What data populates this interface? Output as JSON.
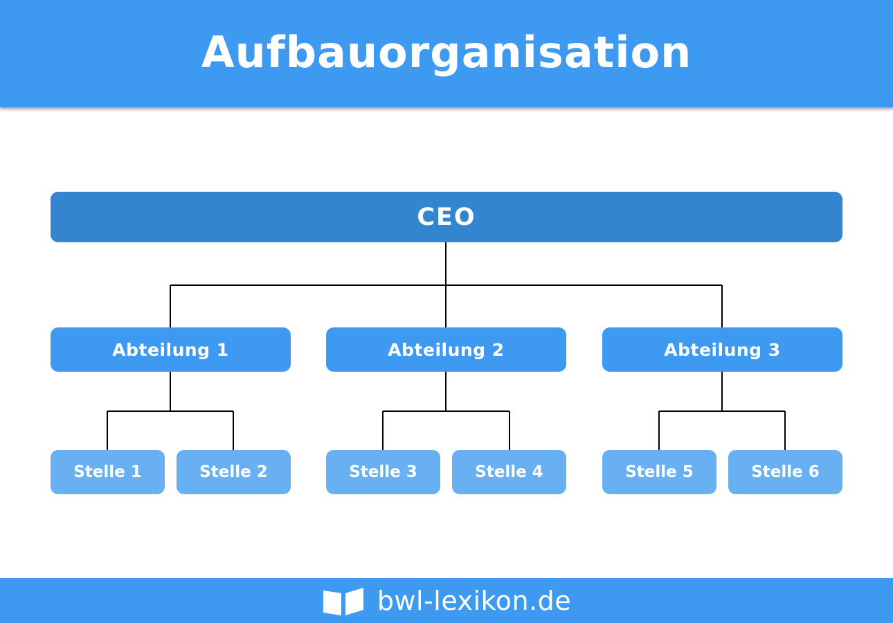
{
  "header": {
    "title": "Aufbauorganisation"
  },
  "org_chart": {
    "root": {
      "label": "CEO"
    },
    "departments": [
      {
        "label": "Abteilung 1",
        "positions": [
          {
            "label": "Stelle 1"
          },
          {
            "label": "Stelle 2"
          }
        ]
      },
      {
        "label": "Abteilung 2",
        "positions": [
          {
            "label": "Stelle 3"
          },
          {
            "label": "Stelle 4"
          }
        ]
      },
      {
        "label": "Abteilung 3",
        "positions": [
          {
            "label": "Stelle 5"
          },
          {
            "label": "Stelle 6"
          }
        ]
      }
    ]
  },
  "colors": {
    "banner": "#3d9af0",
    "root_node": "#3485d0",
    "department_node": "#3d9af0",
    "position_node": "#69b0f2",
    "connector": "#000000",
    "text": "#ffffff"
  },
  "footer": {
    "logo_icon": "open-book-icon",
    "brand": "bwl-lexikon.de"
  }
}
